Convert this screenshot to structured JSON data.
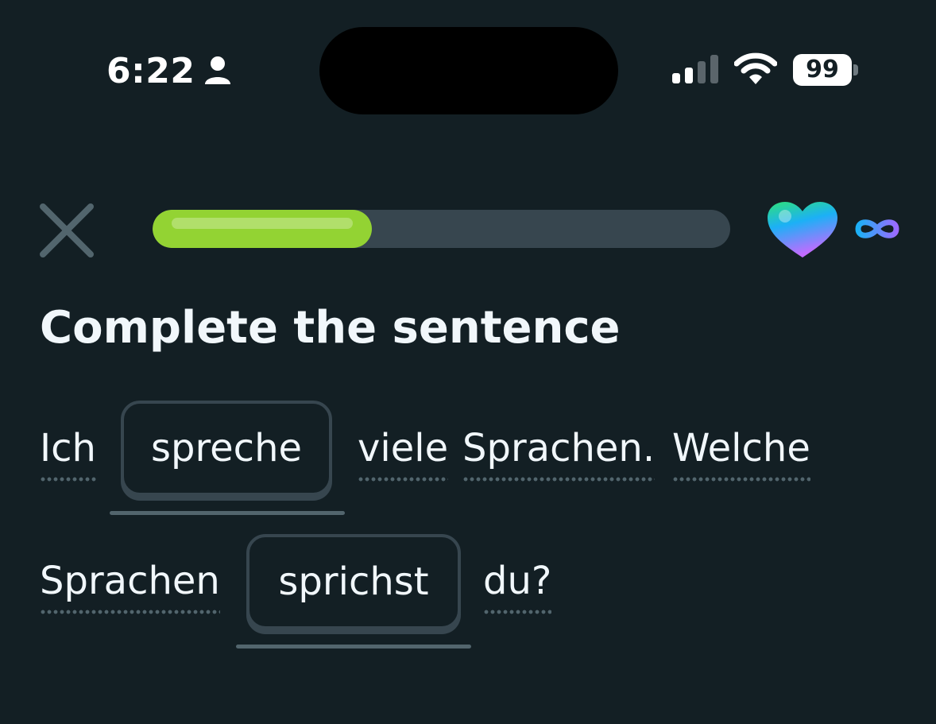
{
  "status_bar": {
    "time": "6:22",
    "battery": "99",
    "icons": [
      "person-icon",
      "signal-icon",
      "wifi-icon"
    ]
  },
  "header": {
    "close_icon": "close-icon",
    "progress_fraction": 0.38,
    "hearts_icon": "heart-icon",
    "hearts_value": "∞"
  },
  "exercise": {
    "title": "Complete the sentence",
    "sentence": {
      "w1": "Ich",
      "blank1": "spreche",
      "w2": "viele",
      "w3": "Sprachen.",
      "w4": "Welche",
      "w5": "Sprachen",
      "blank2": "sprichst",
      "w6": "du?"
    }
  },
  "colors": {
    "background": "#131f24",
    "progress_fill": "#93d333",
    "progress_track": "#37464f",
    "text": "#f1f7fb"
  }
}
